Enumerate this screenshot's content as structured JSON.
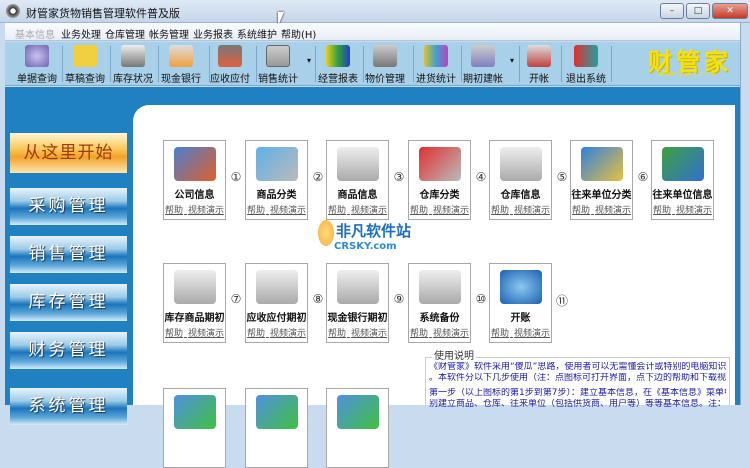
{
  "window": {
    "title": "财管家货物销售管理软件普及版",
    "min": "–",
    "max": "□",
    "close": "✕"
  },
  "menu": [
    "基本信息",
    "业务处理",
    "仓库管理",
    "帐务管理",
    "业务报表",
    "系统维护",
    "帮助(H)"
  ],
  "toolbar": [
    "单据查询",
    "草稿查询",
    "库存状况",
    "现金银行",
    "应收应付",
    "销售统计",
    "经营报表",
    "物价管理",
    "进货统计",
    "期初建帐",
    "开帐",
    "退出系统"
  ],
  "logo": {
    "text": "财管家",
    "url": "www.QQKJL.com"
  },
  "sidebar": [
    "从这里开始",
    "采购管理",
    "销售管理",
    "库存管理",
    "财务管理",
    "系统管理"
  ],
  "tiles_row1": [
    "公司信息",
    "商品分类",
    "商品信息",
    "仓库分类",
    "仓库信息",
    "往来单位分类",
    "往来单位信息"
  ],
  "tiles_row2": [
    "库存商品期初",
    "应收应付期初",
    "现金银行期初",
    "系统备份",
    "开账"
  ],
  "tile_links": {
    "help": "帮助",
    "video": "视频演示"
  },
  "arrows": [
    "①",
    "②",
    "③",
    "④",
    "⑤",
    "⑥",
    "⑦",
    "⑧",
    "⑨",
    "⑩",
    "⑪"
  ],
  "watermark": {
    "name": "非凡软件站",
    "url": "CRSKY.com"
  },
  "usage": {
    "title": "使用说明",
    "lines": [
      "《财管家》软件采用“傻瓜”思路，使用者可以无需懂会计或特别的电脑知识",
      "。本软件分以下几步使用（注：点图标可打开界面，点下边的帮助和下载视频）",
      "第一步（以上图标的第1步到第7步）：建立基本信息，在《基本信息》菜单中，分",
      "别建立商品、仓库、往来单位（包括供货商、用户等）等等基本信息。注："
    ]
  },
  "colors": {
    "body": "#1f80c2",
    "toolbar": "#a8d0e8",
    "start": "#f2a22a"
  }
}
